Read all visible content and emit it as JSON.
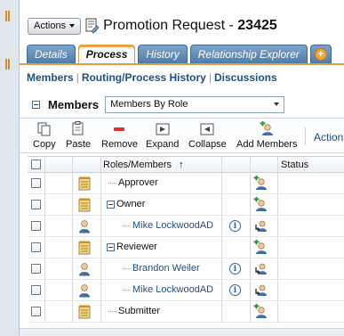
{
  "header": {
    "actions_label": "Actions",
    "title_prefix": "Promotion Request - ",
    "title_number": "23425"
  },
  "tabs": [
    {
      "label": "Details",
      "active": false
    },
    {
      "label": "Process",
      "active": true
    },
    {
      "label": "History",
      "active": false
    },
    {
      "label": "Relationship Explorer",
      "active": false
    }
  ],
  "subnav": [
    "Members",
    "Routing/Process History",
    "Discussions"
  ],
  "members_section": {
    "label": "Members",
    "view_selected": "Members By Role"
  },
  "toolbar": {
    "copy": "Copy",
    "paste": "Paste",
    "remove": "Remove",
    "expand": "Expand",
    "collapse": "Collapse",
    "add_members": "Add Members",
    "more": "Action"
  },
  "grid": {
    "col_roles": "Roles/Members",
    "sort_arrow": "↑",
    "col_status": "Status",
    "rows": [
      {
        "label": "Approver",
        "kind": "role",
        "level": 1,
        "expander": false,
        "info": false,
        "action": "add-member"
      },
      {
        "label": "Owner",
        "kind": "role",
        "level": 1,
        "expander": true,
        "info": false,
        "action": "add-member"
      },
      {
        "label": "Mike LockwoodAD",
        "kind": "person",
        "level": 2,
        "expander": false,
        "info": true,
        "action": "replace-member"
      },
      {
        "label": "Reviewer",
        "kind": "role",
        "level": 1,
        "expander": true,
        "info": false,
        "action": "add-member"
      },
      {
        "label": "Brandon Weiler",
        "kind": "person",
        "level": 2,
        "expander": false,
        "info": true,
        "action": "replace-member"
      },
      {
        "label": "Mike LockwoodAD",
        "kind": "person",
        "level": 2,
        "expander": false,
        "info": true,
        "action": "replace-member"
      },
      {
        "label": "Submitter",
        "kind": "role",
        "level": 1,
        "expander": false,
        "info": false,
        "action": "add-member"
      }
    ]
  },
  "colors": {
    "tab_blue": "#5a86b1",
    "tab_active_border": "#e39a45",
    "link_blue": "#1f4f86",
    "remove_red": "#d9342b"
  }
}
